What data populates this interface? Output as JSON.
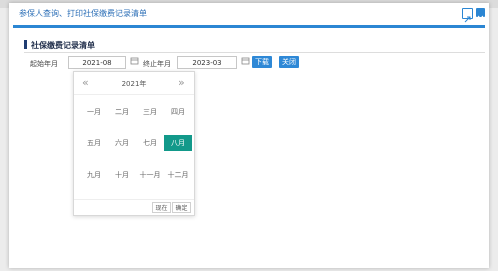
{
  "dialog": {
    "title": "参保人查询、打印社保缴费记录清单"
  },
  "section": {
    "title": "社保缴费记录清单"
  },
  "form": {
    "start_label": "起始年月",
    "start_value": "2021-08",
    "end_label": "终止年月",
    "end_value": "2023-03",
    "download_label": "下载",
    "close_label": "关闭"
  },
  "picker": {
    "prev": "«",
    "next": "»",
    "year": "2021年",
    "months": [
      "一月",
      "二月",
      "三月",
      "四月",
      "五月",
      "六月",
      "七月",
      "八月",
      "九月",
      "十月",
      "十一月",
      "十二月"
    ],
    "selected_month_index": 7,
    "now_label": "现在",
    "ok_label": "确定"
  },
  "colors": {
    "accent": "#2b86d3",
    "selected": "#12998a"
  }
}
